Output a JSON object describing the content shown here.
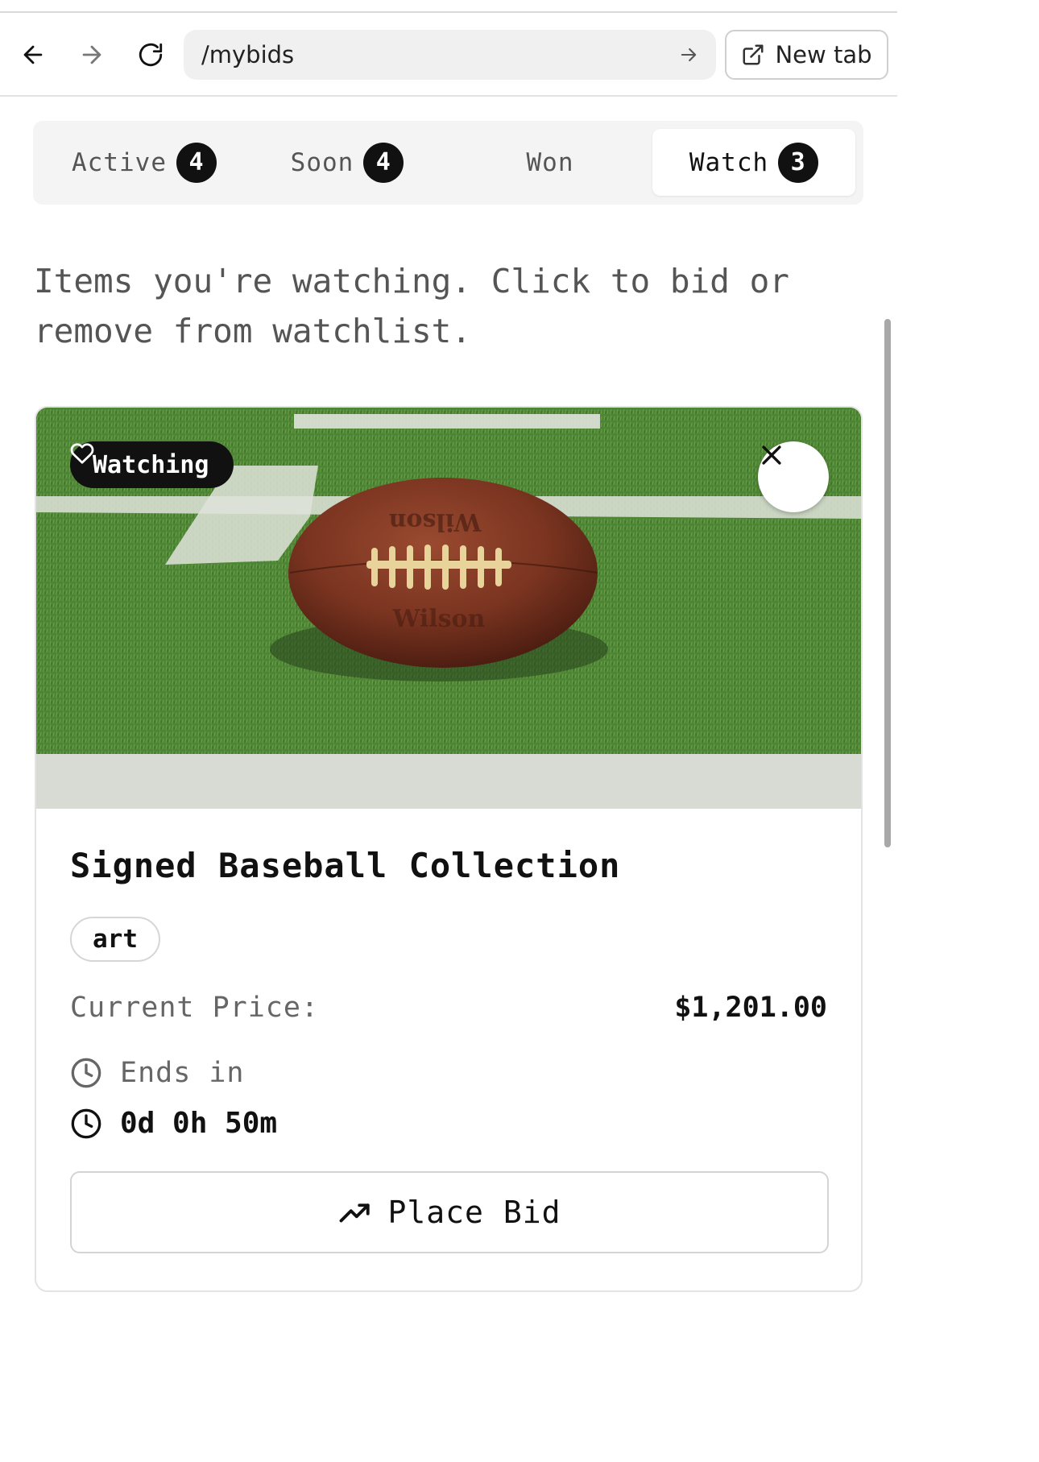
{
  "browser": {
    "url": "/mybids",
    "new_tab_label": "New tab"
  },
  "tabs": [
    {
      "label": "Active",
      "count": "4"
    },
    {
      "label": "Soon",
      "count": "4"
    },
    {
      "label": "Won"
    },
    {
      "label": "Watch",
      "count": "3"
    }
  ],
  "active_tab": "Watch",
  "intro_text": "Items you're watching. Click to bid or remove from watchlist.",
  "item": {
    "watching_label": "Watching",
    "title": "Signed Baseball Collection",
    "tag": "art",
    "price_label": "Current Price:",
    "price_value": "$1,201.00",
    "ends_label": "Ends in",
    "time_left": "0d 0h 50m",
    "bid_button": "Place Bid"
  },
  "icons": {
    "back": "arrow-left-icon",
    "forward": "arrow-right-icon",
    "reload": "reload-icon",
    "go": "arrow-right-icon",
    "new_tab": "external-link-icon",
    "watching": "heart-icon",
    "remove": "close-icon",
    "clock": "clock-icon",
    "bid": "trending-up-icon"
  },
  "colors": {
    "badge": "#111111",
    "active_tab_bg": "#ffffff",
    "tabs_bg": "#f4f4f4"
  }
}
